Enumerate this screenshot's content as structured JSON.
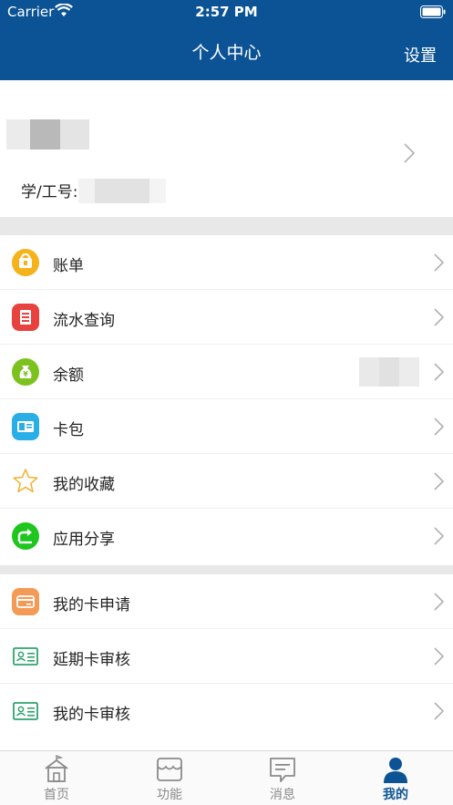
{
  "status_bar": {
    "carrier": "Carrier",
    "time": "2:57 PM"
  },
  "header": {
    "title": "个人中心",
    "settings_label": "设置"
  },
  "profile": {
    "id_label": "学/工号:"
  },
  "menu_group_1": [
    {
      "label": "账单",
      "icon": "bill-icon",
      "color": "#f5b21a"
    },
    {
      "label": "流水查询",
      "icon": "transaction-icon",
      "color": "#e8423f"
    },
    {
      "label": "余额",
      "icon": "money-bag-icon",
      "color": "#7cc21e"
    },
    {
      "label": "卡包",
      "icon": "card-wallet-icon",
      "color": "#29aee6"
    },
    {
      "label": "我的收藏",
      "icon": "star-icon",
      "color": "#f2b43a"
    },
    {
      "label": "应用分享",
      "icon": "share-icon",
      "color": "#1ec61e"
    }
  ],
  "menu_group_2": [
    {
      "label": "我的卡申请",
      "icon": "card-apply-icon",
      "color": "#f39a56"
    },
    {
      "label": "延期卡审核",
      "icon": "id-card-icon",
      "color": "#2ba56b"
    },
    {
      "label": "我的卡审核",
      "icon": "id-card-icon",
      "color": "#2ba56b"
    }
  ],
  "tabs": [
    {
      "label": "首页",
      "icon": "home-icon"
    },
    {
      "label": "功能",
      "icon": "store-icon"
    },
    {
      "label": "消息",
      "icon": "message-icon"
    },
    {
      "label": "我的",
      "icon": "person-icon",
      "active": true
    }
  ],
  "colors": {
    "header_bg": "#0b5394",
    "accent": "#0b5394",
    "separator": "#e8e8e8"
  }
}
